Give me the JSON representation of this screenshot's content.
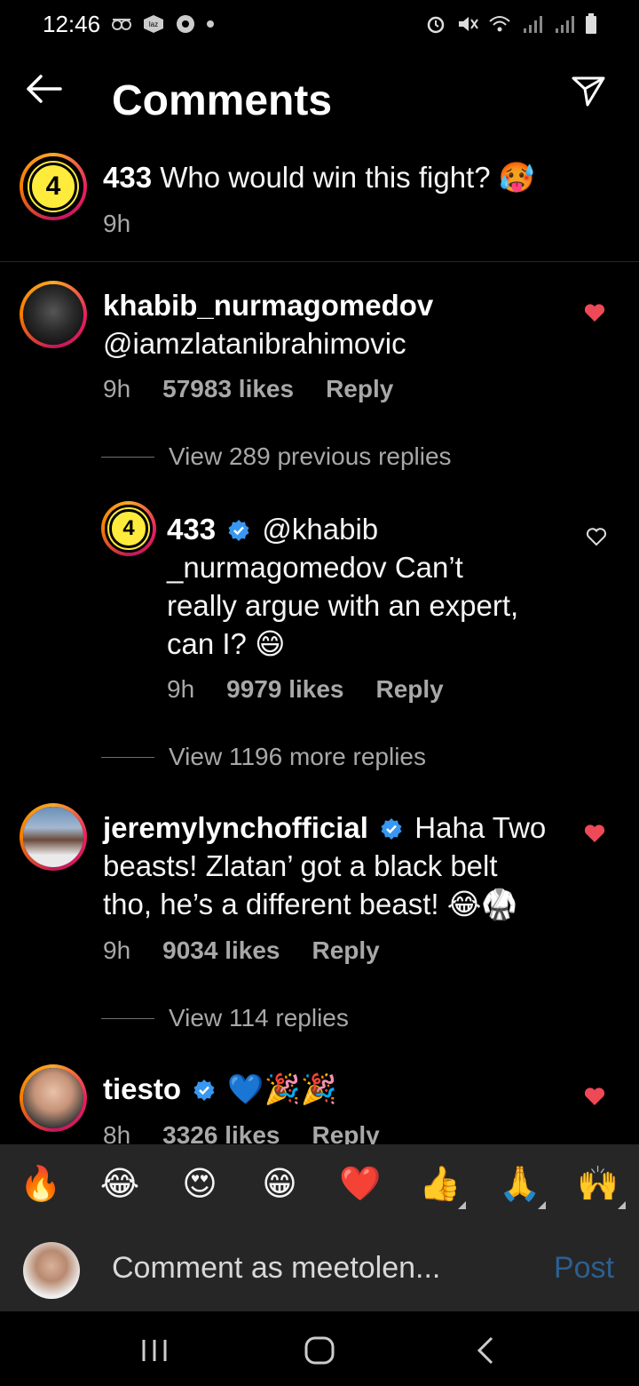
{
  "status_bar": {
    "time": "12:46"
  },
  "header": {
    "title": "Comments"
  },
  "caption": {
    "username": "433",
    "text": "Who would win this fight?",
    "emoji": "🥵",
    "time": "9h",
    "avatar_text": "4"
  },
  "comments": [
    {
      "username": "khabib_nurmagomedov",
      "text": "@iamzlatanibrahimovic",
      "time": "9h",
      "likes": "57983 likes",
      "reply": "Reply"
    },
    {
      "username": "jeremylynchofficial",
      "text_line1": "Haha Two",
      "text_line2": "beasts! Zlatan’ got a black belt",
      "text_line3": "tho, he’s a different beast!",
      "emoji": "😂🥋",
      "time": "9h",
      "likes": "9034 likes",
      "reply": "Reply"
    },
    {
      "username": "tiesto",
      "emoji": "💙🎉🎉",
      "time": "8h",
      "likes": "3326 likes",
      "reply": "Reply"
    }
  ],
  "replies_prev": {
    "label": "View 289 previous replies"
  },
  "reply_433": {
    "username": "433",
    "avatar_text": "4",
    "line1": "@khabib",
    "line2": "_nurmagomedov Can’t",
    "line3": "really argue with an expert,",
    "line4": "can I?",
    "emoji": "😄",
    "time": "9h",
    "likes": "9979 likes",
    "reply": "Reply"
  },
  "replies_more": {
    "label": "View 1196 more replies"
  },
  "replies_jeremy": {
    "label": "View 114 replies"
  },
  "emoji_bar": [
    "🔥",
    "😂",
    "😍",
    "😁",
    "❤️",
    "👍",
    "🙏",
    "🙌"
  ],
  "input": {
    "placeholder": "Comment as meetolen...",
    "post": "Post"
  },
  "colors": {
    "heart_red": "#ed4956",
    "verified_blue": "#3897f0",
    "post_blue": "#2c5f8f"
  }
}
